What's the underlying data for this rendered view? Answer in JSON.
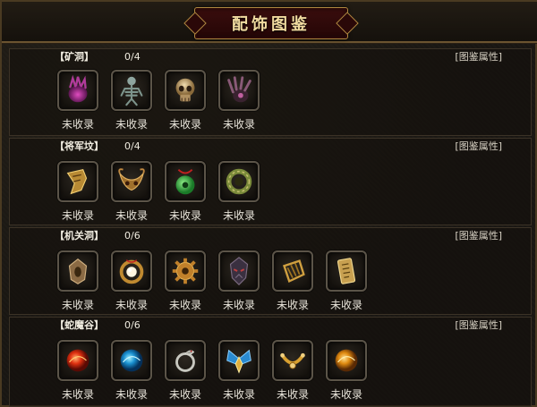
{
  "title": "配饰图鉴",
  "attr_label": "[图鉴属性]",
  "uncollected": "未收录",
  "sections": [
    {
      "name": "【矿洞】",
      "count": "0/4",
      "items": [
        "purple-claw-icon",
        "skeleton-icon",
        "skull-icon",
        "dark-claw-icon"
      ]
    },
    {
      "name": "【将军坟】",
      "count": "0/4",
      "items": [
        "gold-ribbon-icon",
        "horned-mask-icon",
        "jade-pendant-icon",
        "jade-ring-icon"
      ]
    },
    {
      "name": "【机关洞】",
      "count": "0/6",
      "items": [
        "bronze-amulet-icon",
        "pearl-ring-icon",
        "gear-icon",
        "demon-mask-icon",
        "gold-gauntlet-icon",
        "gold-tablet-icon"
      ]
    },
    {
      "name": "【蛇魔谷】",
      "count": "0/6",
      "items": [
        "red-orb-icon",
        "blue-orb-icon",
        "serpent-ring-icon",
        "winged-gem-icon",
        "gold-torque-icon",
        "amber-orb-icon"
      ]
    }
  ]
}
